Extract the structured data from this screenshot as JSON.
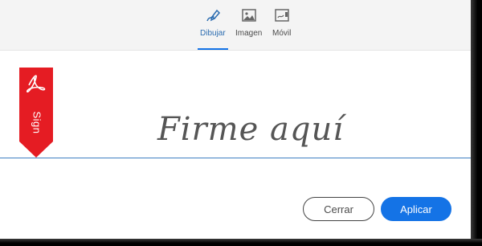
{
  "tabs": [
    {
      "label": "Dibujar",
      "icon": "pen-draw-icon",
      "active": true
    },
    {
      "label": "Imagen",
      "icon": "image-icon",
      "active": false
    },
    {
      "label": "Móvil",
      "icon": "mobile-icon",
      "active": false
    }
  ],
  "sign_tag": {
    "text": "Sign",
    "icon": "acrobat-logo-icon",
    "color": "#e51c23"
  },
  "signature": {
    "placeholder": "Firme aquí"
  },
  "buttons": {
    "close_label": "Cerrar",
    "apply_label": "Aplicar"
  },
  "colors": {
    "accent": "#1473e6",
    "baseline": "#3f7fc2",
    "tag_red": "#e51c23"
  }
}
